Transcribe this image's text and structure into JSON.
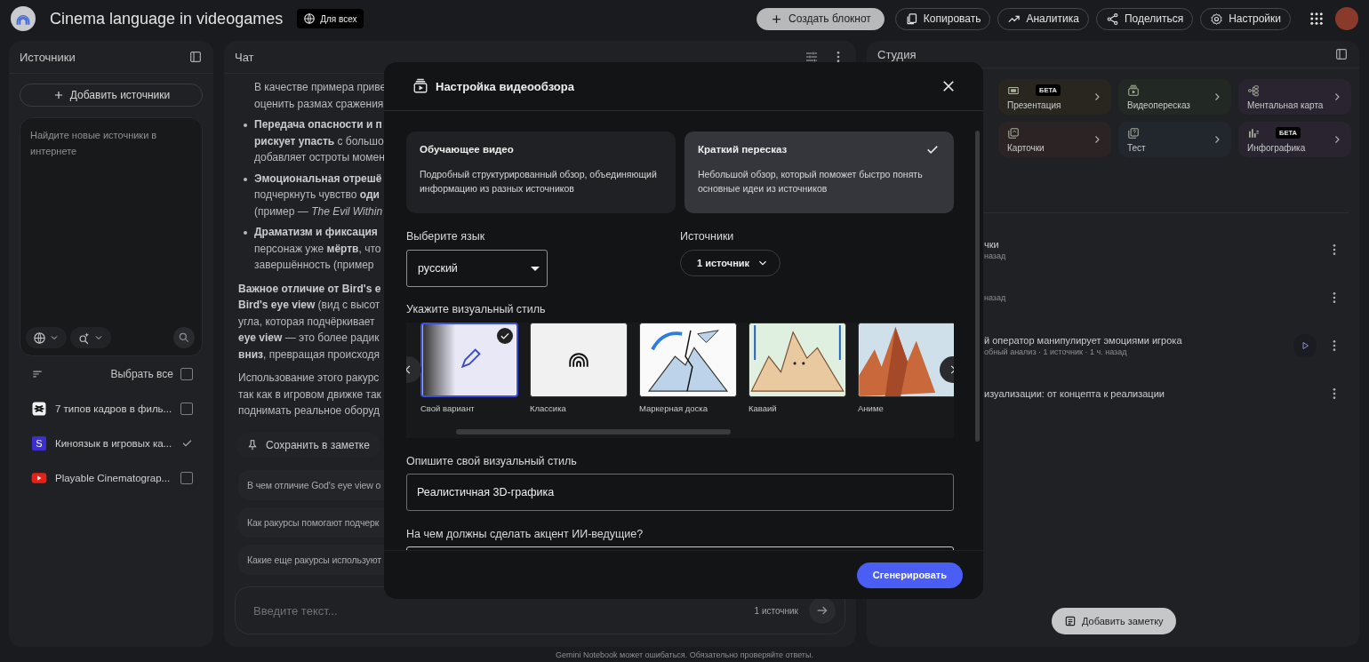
{
  "app": {
    "title": "Cinema language in videogames",
    "visibility": "Для всех"
  },
  "toolbar": [
    {
      "label": "Создать блокнот",
      "kind": "primary"
    },
    {
      "label": "Копировать",
      "kind": "outline"
    },
    {
      "label": "Аналитика",
      "kind": "outline"
    },
    {
      "label": "Поделиться",
      "kind": "outline"
    },
    {
      "label": "Настройки",
      "kind": "outline"
    }
  ],
  "sources_panel": {
    "title": "Источники",
    "add_button": "Добавить источники",
    "search_placeholder": "Найдите новые источники в интернете",
    "select_all": {
      "label": "Выбрать все",
      "checked": false
    },
    "items": [
      {
        "title": "7 типов кадров в филь...",
        "kind": "doc",
        "checked": false
      },
      {
        "title": "Киноязык в игровых ка...",
        "kind": "letter",
        "icon_text": "S",
        "checked": true
      },
      {
        "title": "Playable Cinematograp...",
        "kind": "video",
        "checked": false
      }
    ]
  },
  "chat_panel": {
    "title": "Чат",
    "lines": [
      {
        "text": "В качестве примера приве",
        "kind": "indent"
      },
      {
        "text": "оценить размах сражения",
        "kind": "indent"
      },
      {
        "text": "**Передача опасности и п**",
        "kind": "bullet"
      },
      {
        "text": "**рискует упасть** с большо",
        "kind": "indent"
      },
      {
        "text": "добавляет остроты момен",
        "kind": "indent"
      },
      {
        "text": "**Эмоциональная отрешё**",
        "kind": "bullet"
      },
      {
        "text": "подчеркнуть чувство **оди**",
        "kind": "indent"
      },
      {
        "text": "(пример — *The Evil Within*",
        "kind": "indent"
      },
      {
        "text": "**Драматизм и фиксация**",
        "kind": "bullet"
      },
      {
        "text": "персонаж уже **мёртв**, что",
        "kind": "indent"
      },
      {
        "text": "завершённость (пример",
        "kind": "indent"
      },
      {
        "text": "**Важное отличие от Bird's e**",
        "kind": "para"
      },
      {
        "text": "**Bird's eye view** (вид с высот",
        "kind": "line"
      },
      {
        "text": "угла, которая подчёркивает",
        "kind": "line"
      },
      {
        "text": "**eye view** — это более радик",
        "kind": "line"
      },
      {
        "text": "**вниз**, превращая происходя",
        "kind": "line"
      },
      {
        "text": "Использование этого ракурс",
        "kind": "para"
      },
      {
        "text": "так как в игровом движке так",
        "kind": "line"
      },
      {
        "text": "поднимать реальное оборуд",
        "kind": "line"
      }
    ],
    "save_button": "Сохранить в заметке",
    "suggestions": [
      "В чем отличие God's eye view о",
      "Как ракурсы помогают подчерк",
      "Какие еще ракурсы используют"
    ],
    "input": {
      "placeholder": "Введите текст...",
      "source_count": "1 источник"
    }
  },
  "studio_panel": {
    "title": "Студия",
    "tiles": [
      {
        "label": "Презентация",
        "badge": "БЕТА",
        "color": "#29261f"
      },
      {
        "label": "Видеопересказ",
        "color": "#222823"
      },
      {
        "label": "Ментальная карта",
        "color": "#2a2330"
      },
      {
        "label": "Карточки",
        "color": "#2c2325"
      },
      {
        "label": "Тест",
        "color": "#22272e"
      },
      {
        "label": "Инфографика",
        "badge": "БЕТА",
        "color": "#2a2330"
      }
    ],
    "notes": [
      {
        "title": "чки",
        "meta": "назад",
        "playable": false
      },
      {
        "meta": "назад",
        "playable": false
      },
      {
        "title": "й оператор манипулирует эмоциями игрока",
        "meta": "обный анализ · 1 источник · 1 ч. назад",
        "playable": true
      },
      {
        "title": "изуализации: от концепта к реализации",
        "playable": false
      }
    ],
    "add_note_button": "Добавить заметку"
  },
  "dialog": {
    "title": "Настройка видеообзора",
    "formats": [
      {
        "title": "Обучающее видео",
        "description": "Подробный структурированный обзор, объединяющий информацию из разных источников",
        "selected": false
      },
      {
        "title": "Краткий пересказ",
        "description": "Небольшой обзор, который поможет быстро понять основные идеи из источников",
        "selected": true
      }
    ],
    "language": {
      "label": "Выберите язык",
      "value": "русский"
    },
    "sources": {
      "label": "Источники",
      "value": "1 источник"
    },
    "style": {
      "label": "Укажите визуальный стиль",
      "options": [
        {
          "label": "Свой вариант",
          "kind": "custom",
          "selected": true
        },
        {
          "label": "Классика",
          "kind": "classic",
          "selected": false
        },
        {
          "label": "Маркерная доска",
          "kind": "whiteboard",
          "selected": false
        },
        {
          "label": "Каваий",
          "kind": "kawaii",
          "selected": false
        },
        {
          "label": "Аниме",
          "kind": "anime",
          "selected": false
        }
      ]
    },
    "style_description": {
      "label": "Опишите свой визуальный стиль",
      "value": "Реалистичная 3D-графика"
    },
    "focus": {
      "label": "На чем должны сделать акцент ИИ-ведущие?"
    },
    "generate_button": "Сгенерировать"
  },
  "footer": "Gemini Notebook может ошибаться. Обязательно проверяйте ответы."
}
